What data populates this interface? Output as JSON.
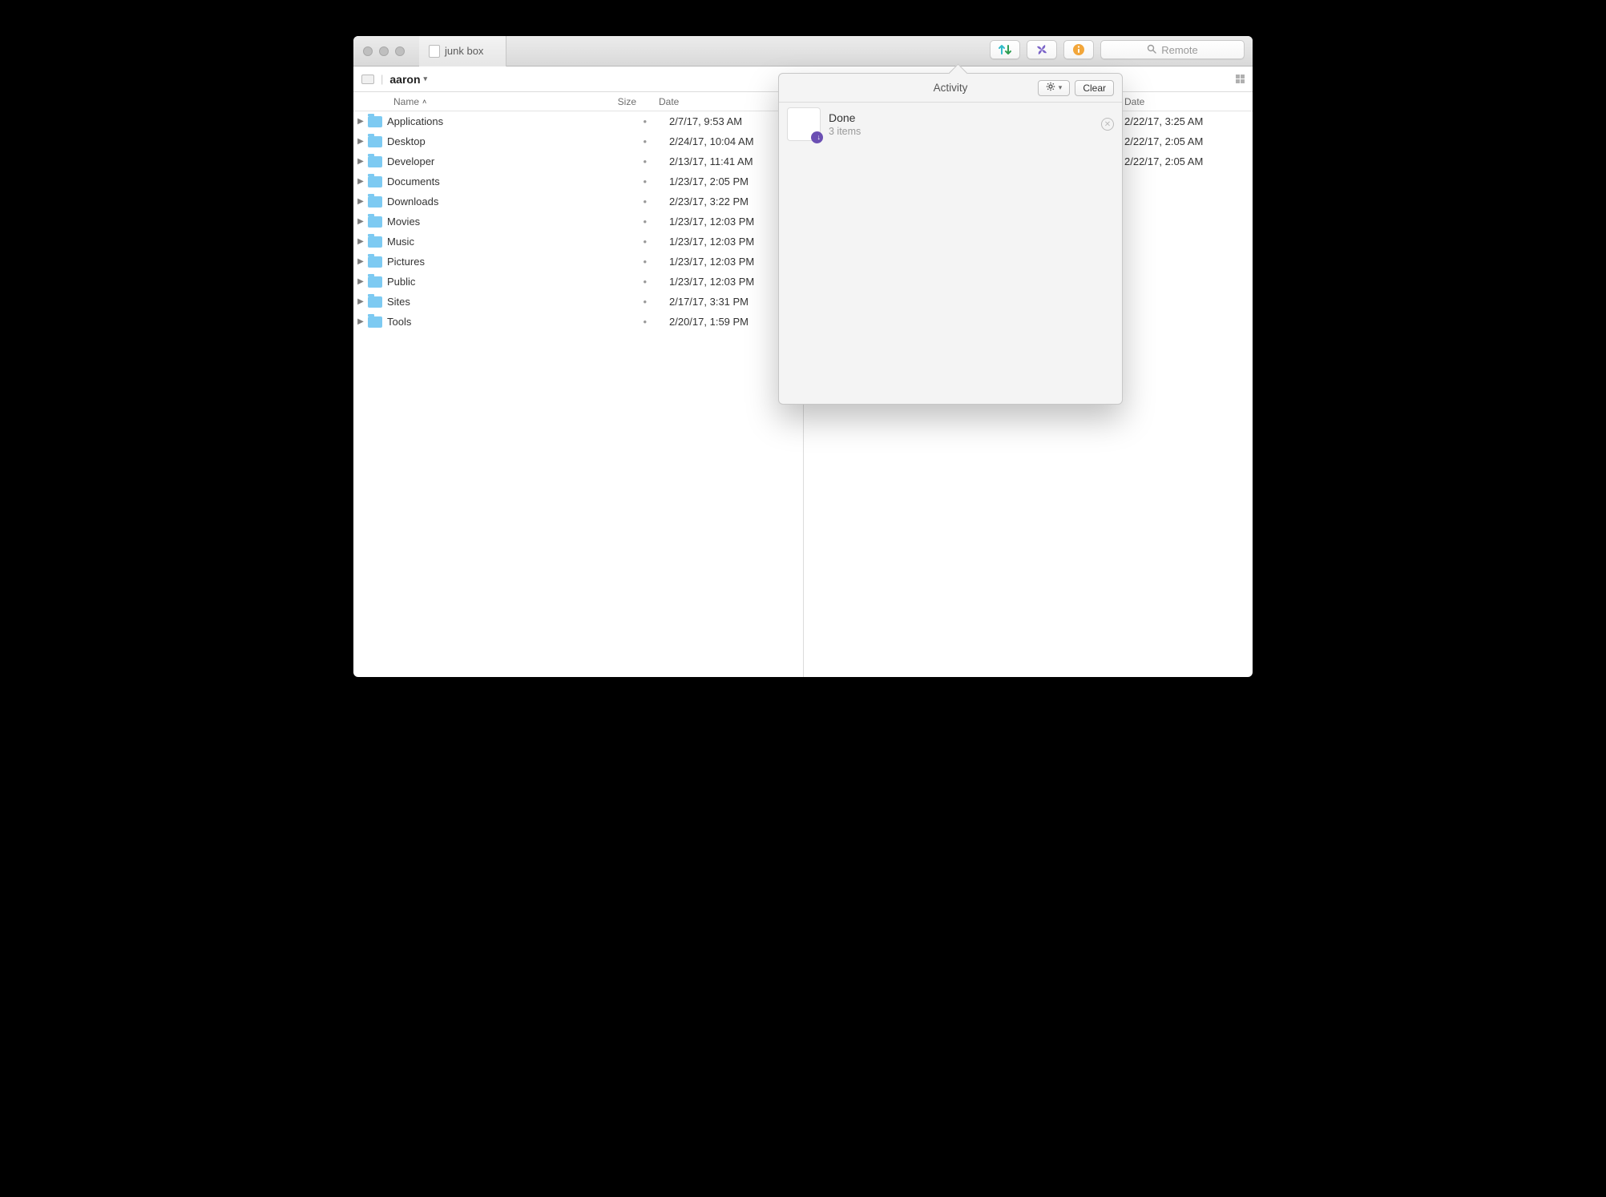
{
  "window": {
    "tab_title": "junk box",
    "search_placeholder": "Remote"
  },
  "pathbar": {
    "crumb": "aaron"
  },
  "columns": {
    "name": "Name",
    "size": "Size",
    "date": "Date",
    "date_right": "Date"
  },
  "size_bullet": "•",
  "left_rows": [
    {
      "name": "Applications",
      "date": "2/7/17, 9:53 AM"
    },
    {
      "name": "Desktop",
      "date": "2/24/17, 10:04 AM"
    },
    {
      "name": "Developer",
      "date": "2/13/17, 11:41 AM"
    },
    {
      "name": "Documents",
      "date": "1/23/17, 2:05 PM"
    },
    {
      "name": "Downloads",
      "date": "2/23/17, 3:22 PM"
    },
    {
      "name": "Movies",
      "date": "1/23/17, 12:03 PM"
    },
    {
      "name": "Music",
      "date": "1/23/17, 12:03 PM"
    },
    {
      "name": "Pictures",
      "date": "1/23/17, 12:03 PM"
    },
    {
      "name": "Public",
      "date": "1/23/17, 12:03 PM"
    },
    {
      "name": "Sites",
      "date": "2/17/17, 3:31 PM"
    },
    {
      "name": "Tools",
      "date": "2/20/17, 1:59 PM"
    }
  ],
  "right_rows": [
    {
      "date": "2/22/17, 3:25 AM"
    },
    {
      "date": "2/22/17, 2:05 AM"
    },
    {
      "date": "2/22/17, 2:05 AM"
    }
  ],
  "popover": {
    "title": "Activity",
    "clear": "Clear",
    "item_title": "Done",
    "item_sub": "3 items"
  }
}
